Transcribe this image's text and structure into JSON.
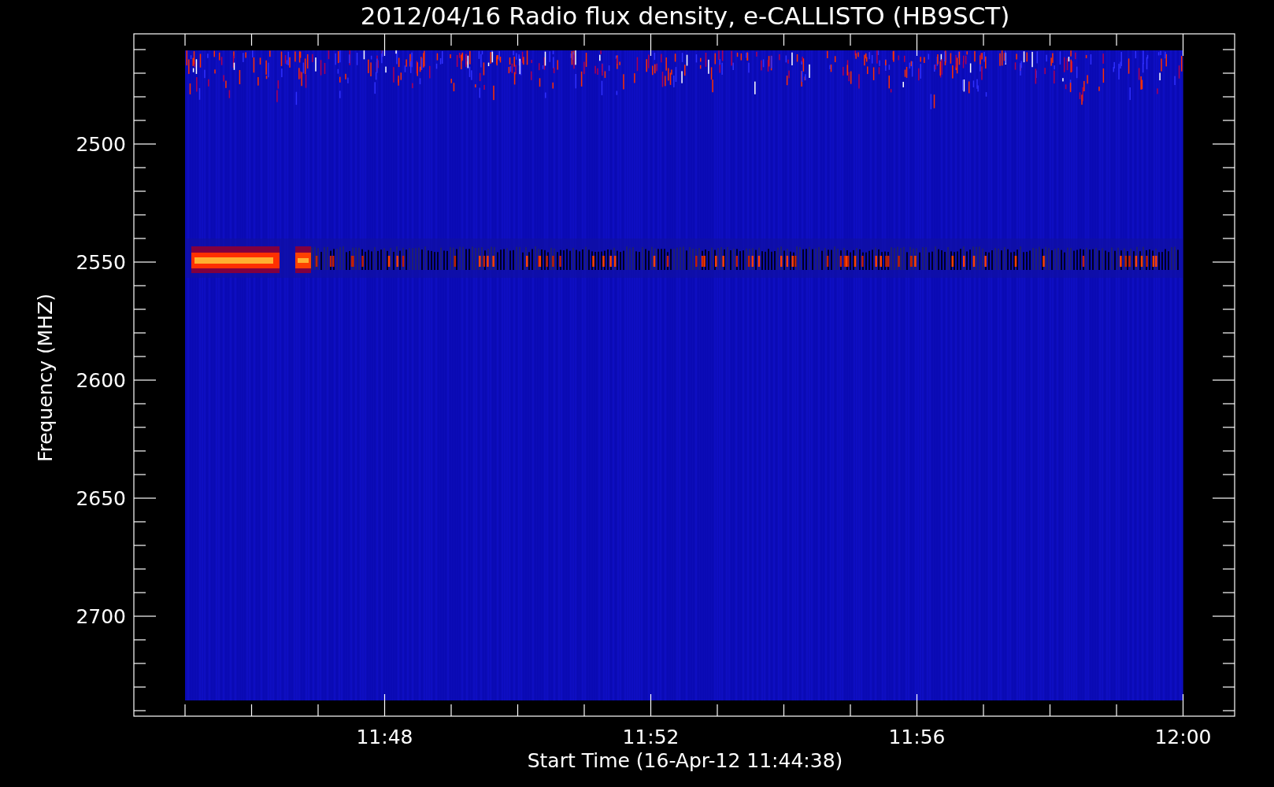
{
  "title": "2012/04/16  Radio flux density, e-CALLISTO (HB9SCT)",
  "y_axis": {
    "label": "Frequency (MHZ)",
    "ticks": [
      "2500",
      "2550",
      "2600",
      "2650",
      "2700"
    ]
  },
  "x_axis": {
    "label": "Start Time (16-Apr-12 11:44:38)",
    "ticks": [
      "11:48",
      "11:52",
      "11:56",
      "12:00"
    ]
  }
}
